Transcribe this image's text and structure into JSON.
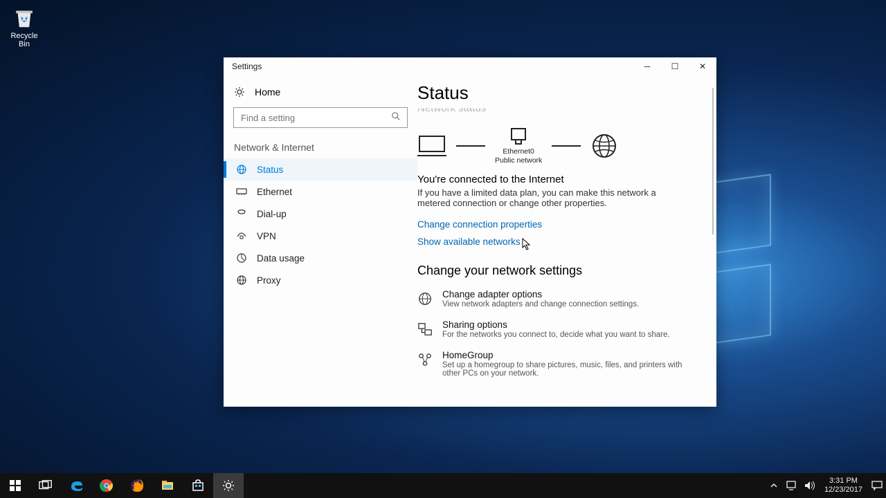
{
  "desktop": {
    "recycle_bin": "Recycle Bin"
  },
  "window": {
    "title": "Settings",
    "home": "Home",
    "search_placeholder": "Find a setting",
    "section": "Network & Internet",
    "nav": {
      "status": "Status",
      "ethernet": "Ethernet",
      "dialup": "Dial-up",
      "vpn": "VPN",
      "datausage": "Data usage",
      "proxy": "Proxy"
    }
  },
  "content": {
    "title": "Status",
    "ghost": "Network status",
    "adapter_name": "Ethernet0",
    "adapter_type": "Public network",
    "connected_heading": "You're connected to the Internet",
    "connected_body": "If you have a limited data plan, you can make this network a metered connection or change other properties.",
    "link_change": "Change connection properties",
    "link_show": "Show available networks",
    "change_heading": "Change your network settings",
    "opt1_t": "Change adapter options",
    "opt1_d": "View network adapters and change connection settings.",
    "opt2_t": "Sharing options",
    "opt2_d": "For the networks you connect to, decide what you want to share.",
    "opt3_t": "HomeGroup",
    "opt3_d": "Set up a homegroup to share pictures, music, files, and printers with other PCs on your network."
  },
  "taskbar": {
    "time": "3:31 PM",
    "date": "12/23/2017"
  }
}
